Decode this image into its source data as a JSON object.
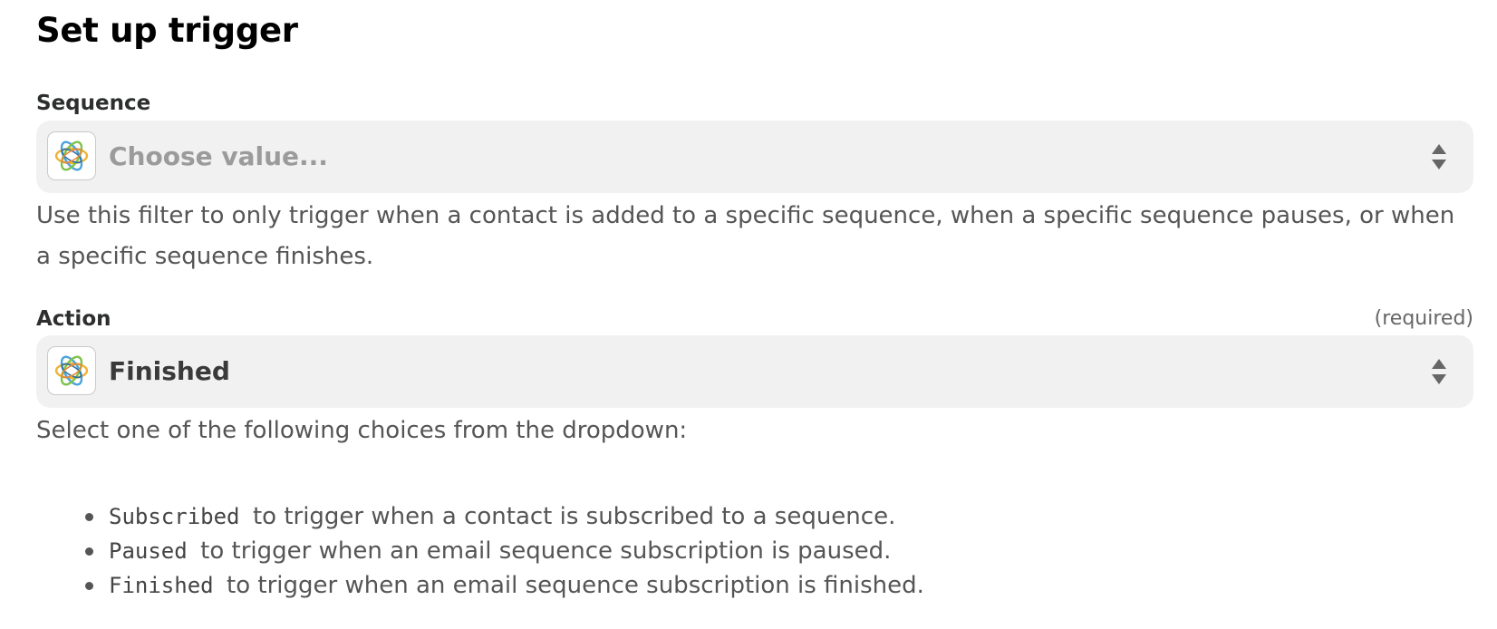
{
  "header": {
    "title": "Set up trigger"
  },
  "sequence_field": {
    "label": "Sequence",
    "placeholder": "Choose value...",
    "app_icon": "drip-app-icon",
    "help_text": "Use this filter to only trigger when a contact is added to a specific sequence, when a specific sequence pauses, or when a specific sequence finishes."
  },
  "action_field": {
    "label": "Action",
    "required_hint": "(required)",
    "value": "Finished",
    "app_icon": "drip-app-icon",
    "help_text": "Select one of the following choices from the dropdown:",
    "choices": [
      {
        "code": "Subscribed",
        "description": "to trigger when a contact is subscribed to a sequence."
      },
      {
        "code": "Paused",
        "description": "to trigger when an email sequence subscription is paused."
      },
      {
        "code": "Finished",
        "description": "to trigger when an email sequence subscription is finished."
      }
    ]
  },
  "colors": {
    "select_background": "#f1f1f1",
    "placeholder_text": "#9b9b9b",
    "help_text": "#555555"
  }
}
